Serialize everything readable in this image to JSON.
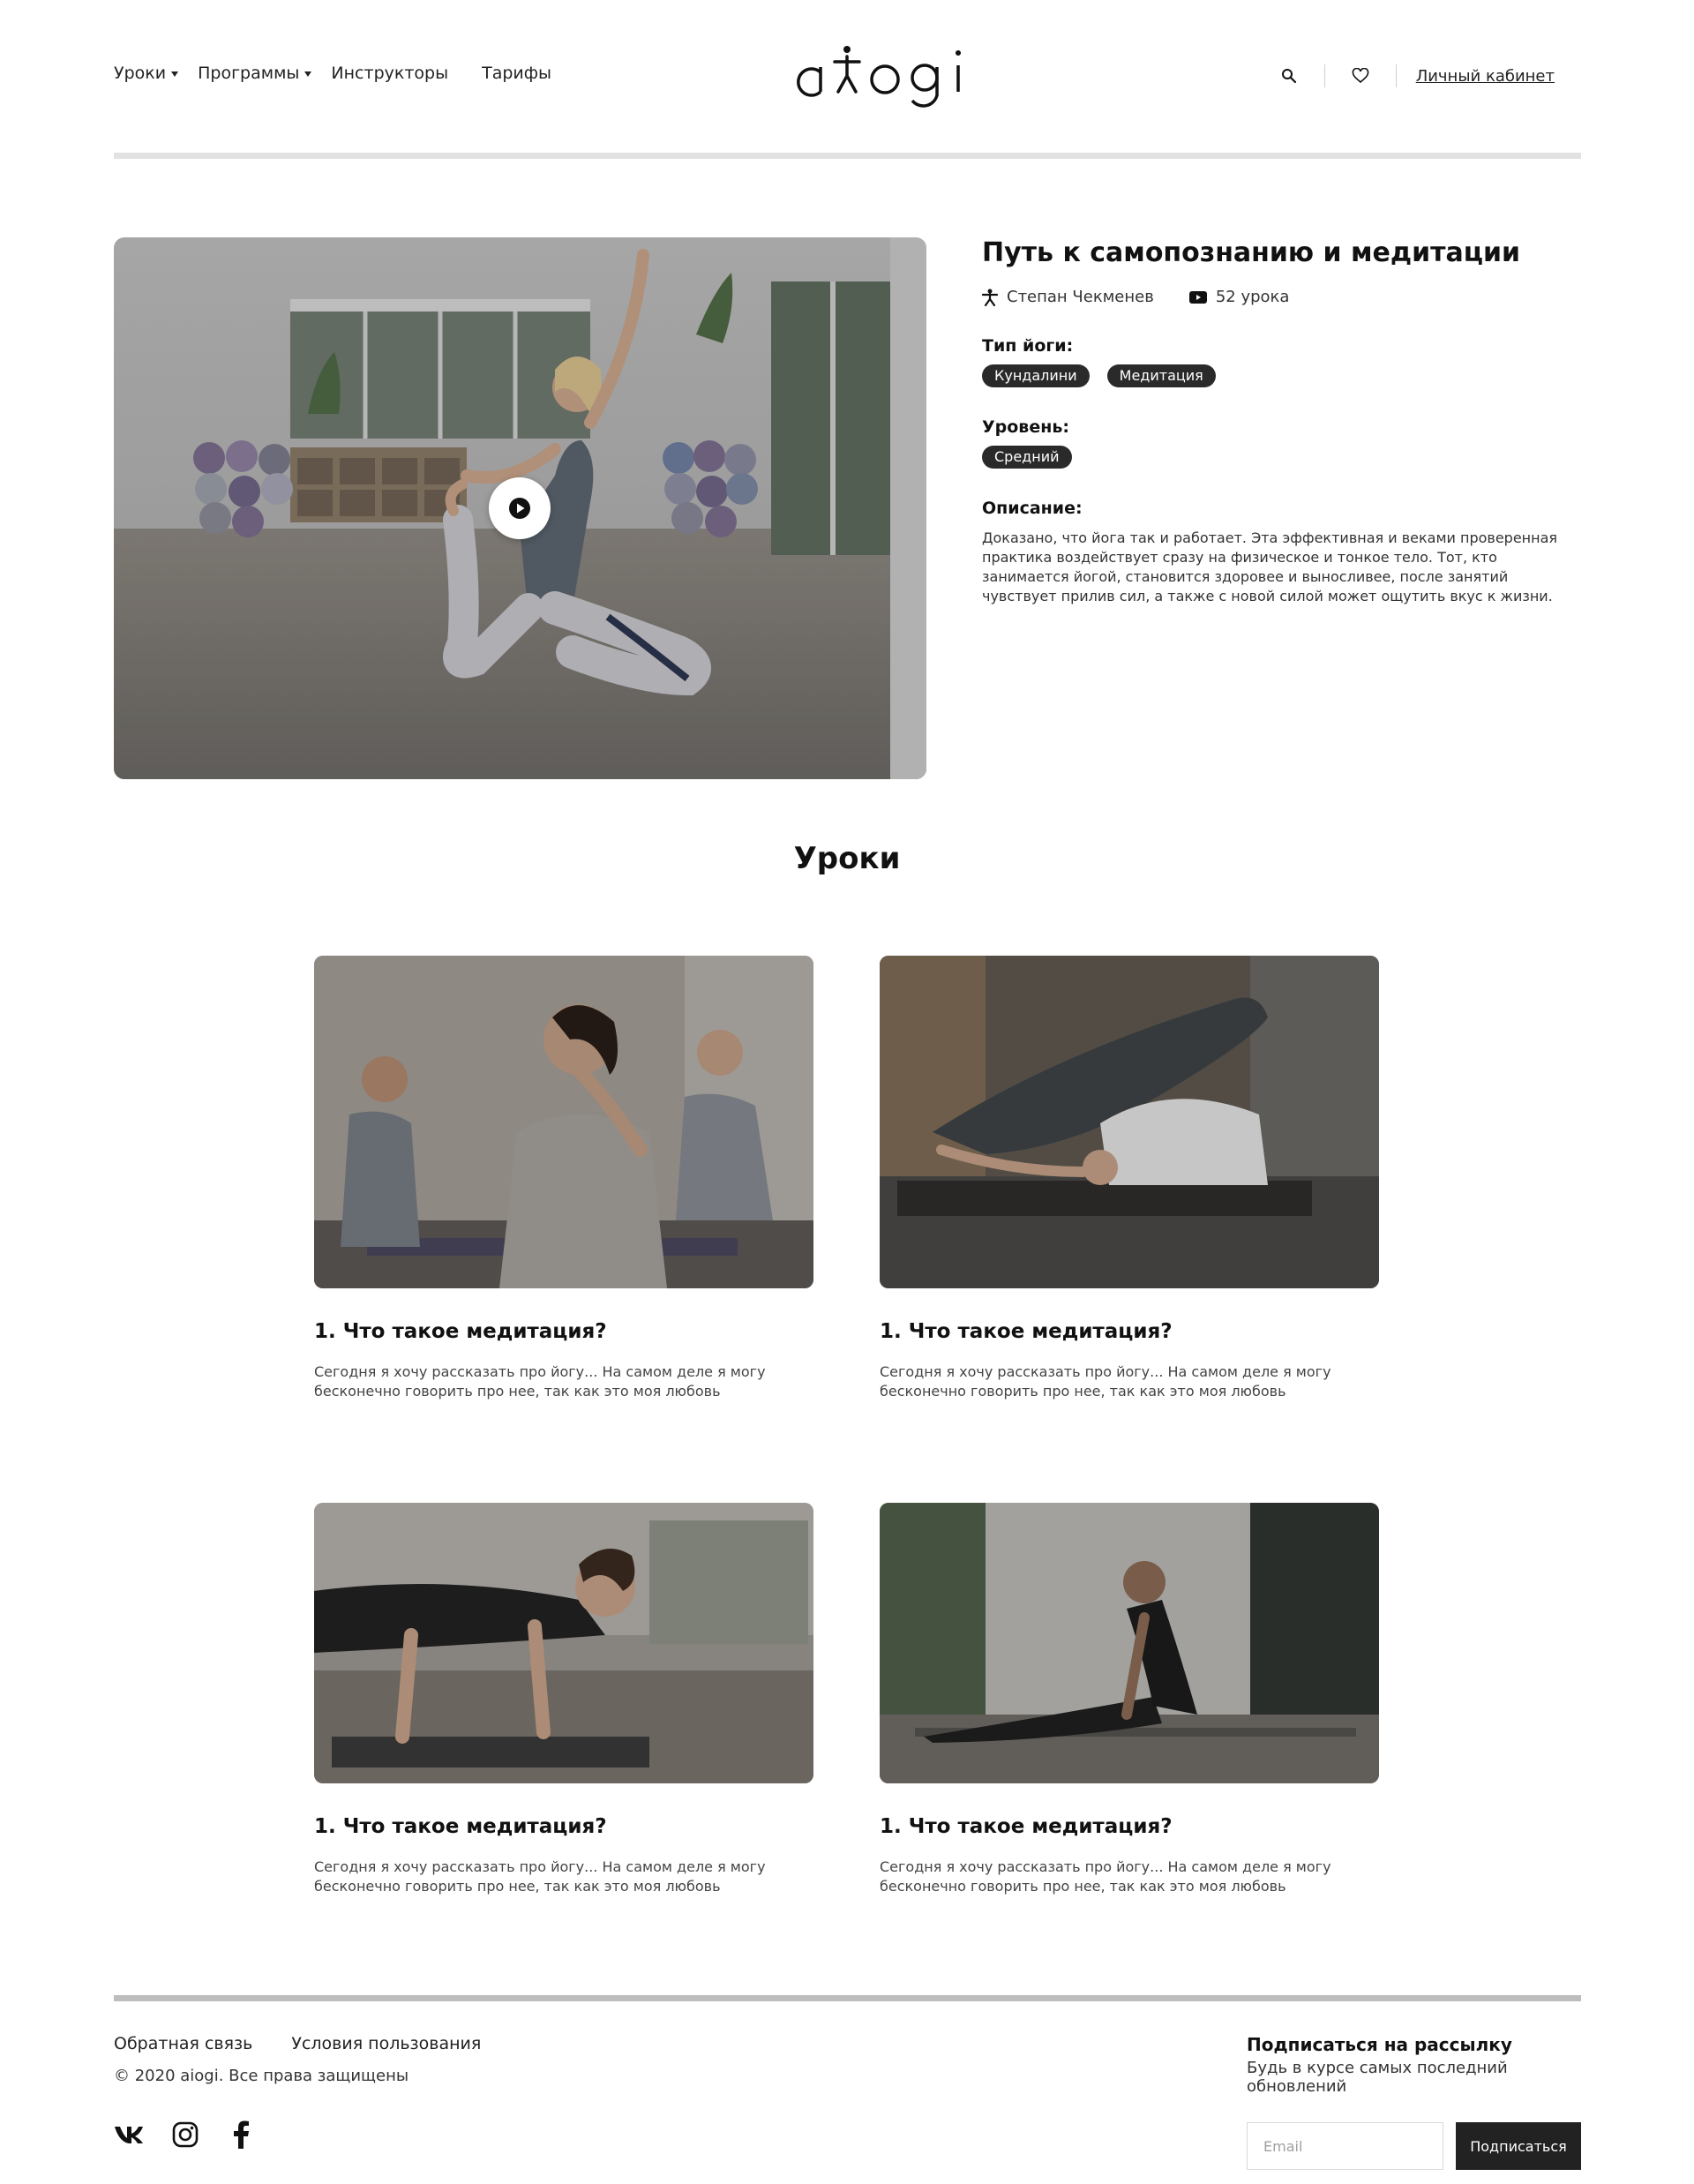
{
  "header": {
    "nav": [
      {
        "label": "Уроки",
        "has_dropdown": true
      },
      {
        "label": "Программы",
        "has_dropdown": true
      },
      {
        "label": "Инструкторы",
        "has_dropdown": false
      },
      {
        "label": "Тарифы",
        "has_dropdown": false
      }
    ],
    "logo": "aiogi",
    "search_icon": "search-icon",
    "favorites_icon": "heart-icon",
    "account_label": "Личный кабинет"
  },
  "program": {
    "title": "Путь к самопознанию и медитации",
    "instructor": "Степан Чекменев",
    "lessons_count": "52 урока",
    "yoga_type_label": "Тип йоги:",
    "yoga_types": [
      "Кундалини",
      "Медитация"
    ],
    "level_label": "Уровень:",
    "level": "Средний",
    "description_label": "Описание:",
    "description": "Доказано, что йога так и работает. Эта эффективная и веками проверенная практика воздействует сразу на физическое и тонкое тело. Тот, кто занимается йогой, становится здоровее и выносливее, после занятий чувствует прилив сил, а также с новой силой может ощутить вкус к жизни."
  },
  "lessons": {
    "section_title": "Уроки",
    "items": [
      {
        "title": "1. Что такое медитация?",
        "text": "Сегодня я хочу рассказать про йогу... На самом деле я могу бесконечно говорить про нее, так как это моя любовь"
      },
      {
        "title": "1. Что такое медитация?",
        "text": "Сегодня я хочу рассказать про йогу... На самом деле я могу бесконечно говорить про нее, так как это моя любовь"
      },
      {
        "title": "1. Что такое медитация?",
        "text": "Сегодня я хочу рассказать про йогу... На самом деле я могу бесконечно говорить про нее, так как это моя любовь"
      },
      {
        "title": "1. Что такое медитация?",
        "text": "Сегодня я хочу рассказать про йогу... На самом деле я могу бесконечно говорить про нее, так как это моя любовь"
      }
    ]
  },
  "footer": {
    "links": [
      "Обратная связь",
      "Условия пользования"
    ],
    "copyright": "© 2020 aiogi. Все права защищены",
    "socials": [
      "vk-icon",
      "instagram-icon",
      "facebook-icon"
    ],
    "subscribe_title": "Подписаться на рассылку",
    "subscribe_subtitle": "Будь в курсе самых последний обновлений",
    "email_placeholder": "Email",
    "subscribe_button": "Подписаться"
  },
  "colors": {
    "text": "#111111",
    "tag_bg": "#2a2a2a",
    "button_bg": "#222222",
    "rule": "#e2e2e2"
  }
}
